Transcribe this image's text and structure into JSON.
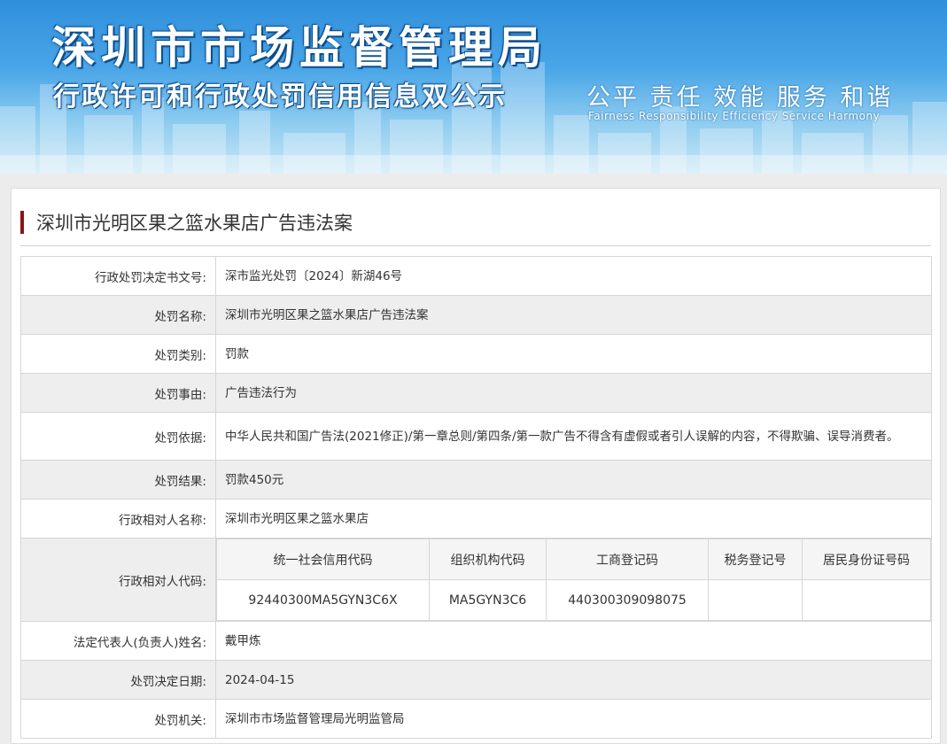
{
  "banner": {
    "title": "深圳市市场监督管理局",
    "subtitle": "行政许可和行政处罚信用信息双公示",
    "motto": "公平 责任 效能 服务 和谐",
    "motto_en": "Fairness  Responsibility  Efficiency  Service  Harmony"
  },
  "case": {
    "title": "深圳市光明区果之篮水果店广告违法案"
  },
  "rows": [
    {
      "label": "行政处罚决定书文号:",
      "value": "深市监光处罚〔2024〕新湖46号"
    },
    {
      "label": "处罚名称:",
      "value": "深圳市光明区果之篮水果店广告违法案"
    },
    {
      "label": "处罚类别:",
      "value": "罚款"
    },
    {
      "label": "处罚事由:",
      "value": "广告违法行为"
    },
    {
      "label": "处罚依据:",
      "value": "中华人民共和国广告法(2021修正)/第一章总则/第四条/第一款广告不得含有虚假或者引人误解的内容，不得欺骗、误导消费者。"
    },
    {
      "label": "处罚结果:",
      "value": "罚款450元"
    },
    {
      "label": "行政相对人名称:",
      "value": "深圳市光明区果之篮水果店"
    }
  ],
  "codes": {
    "label": "行政相对人代码:",
    "headers": [
      "统一社会信用代码",
      "组织机构代码",
      "工商登记码",
      "税务登记号",
      "居民身份证号码"
    ],
    "values": [
      "92440300MA5GYN3C6X",
      "MA5GYN3C6",
      "440300309098075",
      "",
      ""
    ]
  },
  "rows_after": [
    {
      "label": "法定代表人(负责人)姓名:",
      "value": "戴甲炼"
    },
    {
      "label": "处罚决定日期:",
      "value": "2024-04-15"
    },
    {
      "label": "处罚机关:",
      "value": "深圳市市场监督管理局光明监管局"
    }
  ]
}
